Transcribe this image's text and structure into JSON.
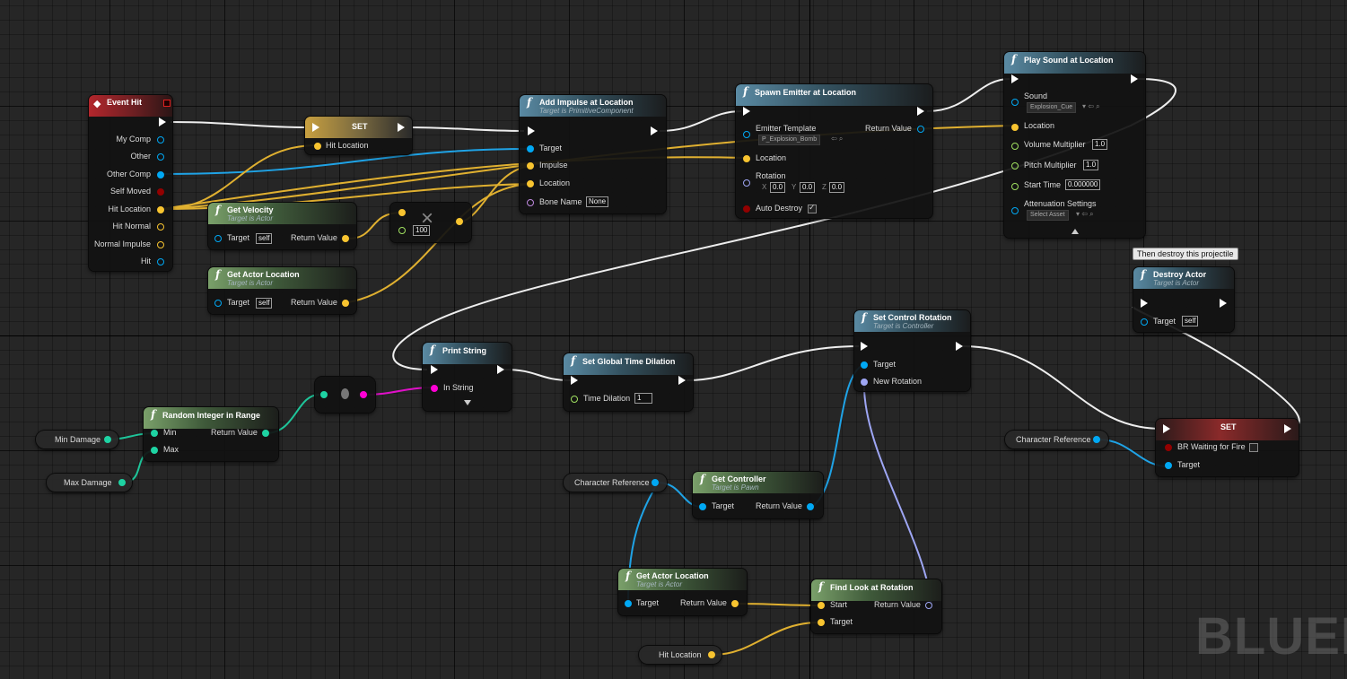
{
  "colors": {
    "exec": "#ffffff",
    "object": "#00a8f4",
    "struct": "#f8c430",
    "vector_float": "#a0e060",
    "integer": "#1ed3a3",
    "string": "#ff00d4",
    "rotator": "#9ea6f4",
    "boolean": "#920101"
  },
  "event_hit": {
    "title": "Event Hit",
    "pins": [
      "My Comp",
      "Other",
      "Other Comp",
      "Self Moved",
      "Hit Location",
      "Hit Normal",
      "Normal Impulse",
      "Hit"
    ]
  },
  "set_hit": {
    "title": "SET",
    "pin": "Hit Location"
  },
  "add_impulse": {
    "title": "Add Impulse at Location",
    "subtitle": "Target is PrimitiveComponent",
    "pins": [
      "Target",
      "Impulse",
      "Location",
      "Bone Name"
    ],
    "bone_name": "None"
  },
  "spawn_emitter": {
    "title": "Spawn Emitter at Location",
    "pins": [
      "Emitter Template",
      "Location",
      "Rotation",
      "Auto Destroy"
    ],
    "template_value": "P_Explosion_Bomb",
    "return": "Return Value",
    "rot_x": "0.0",
    "rot_y": "0.0",
    "rot_z": "0.0",
    "x_lbl": "X",
    "y_lbl": "Y",
    "z_lbl": "Z"
  },
  "play_sound": {
    "title": "Play Sound at Location",
    "pins": [
      "Sound",
      "Location",
      "Volume Multiplier",
      "Pitch Multiplier",
      "Start Time",
      "Attenuation Settings"
    ],
    "sound_value": "Explosion_Cue",
    "volume": "1.0",
    "pitch": "1.0",
    "start_time": "0.000000",
    "attenuation_value": "Select Asset"
  },
  "get_velocity": {
    "title": "Get Velocity",
    "subtitle": "Target is Actor",
    "target": "Target",
    "self": "self",
    "return": "Return Value"
  },
  "get_actor_location_1": {
    "title": "Get Actor Location",
    "subtitle": "Target is Actor",
    "target": "Target",
    "self": "self",
    "return": "Return Value"
  },
  "multiply": {
    "value": "100"
  },
  "destroy_actor": {
    "tooltip": "Then destroy this projectile",
    "title": "Destroy Actor",
    "subtitle": "Target is Actor",
    "target": "Target",
    "self": "self"
  },
  "print_string": {
    "title": "Print String",
    "pin": "In String"
  },
  "set_time": {
    "title": "Set Global Time Dilation",
    "pin": "Time Dilation",
    "value": "1"
  },
  "set_control_rotation": {
    "title": "Set Control Rotation",
    "subtitle": "Target is Controller",
    "pins": [
      "Target",
      "New Rotation"
    ]
  },
  "random_int": {
    "title": "Random Integer in Range",
    "pins": [
      "Min",
      "Max"
    ],
    "return": "Return Value"
  },
  "vars": {
    "min_damage": "Min Damage",
    "max_damage": "Max Damage",
    "character_ref_1": "Character Reference",
    "character_ref_2": "Character Reference",
    "hit_location": "Hit Location"
  },
  "set_br": {
    "title": "SET",
    "pins": [
      "BR Waiting for Fire",
      "Target"
    ]
  },
  "get_controller": {
    "title": "Get Controller",
    "subtitle": "Target is Pawn",
    "target": "Target",
    "return": "Return Value"
  },
  "get_actor_location_2": {
    "title": "Get Actor Location",
    "subtitle": "Target is Actor",
    "target": "Target",
    "return": "Return Value"
  },
  "find_look": {
    "title": "Find Look at Rotation",
    "pins": [
      "Start",
      "Target"
    ],
    "return": "Return Value"
  },
  "watermark": "BLUEI"
}
